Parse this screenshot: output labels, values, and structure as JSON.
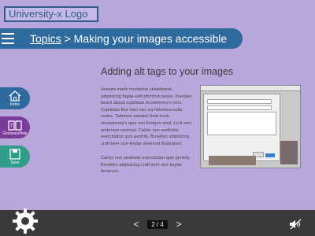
{
  "logo": {
    "text": "University-x Logo"
  },
  "header": {
    "breadcrumb_link": "Topics",
    "breadcrumb_rest": " > Making your images accessible"
  },
  "sidebar": {
    "items": [
      {
        "label": "Index",
        "icon": "home-icon"
      },
      {
        "label": "Glossary/Help",
        "icon": "book-question-icon"
      },
      {
        "label": "Save",
        "icon": "save-icon"
      }
    ]
  },
  "content": {
    "title": "Adding alt tags to your images",
    "paragraphs": [
      "Veniam marfa mustache skateboard, adipisicing fugiat velit pitchfork beard. Freegan beard aliqua cupidatat mcsweeney's vero. Cupidatat four loko nisi, ea helvetica nulla carles. Tattooed sweater food truck, mcsweeney's quis non freegan vinyl. Lo-fi wes anderson sartorial. Carles non aesthetic exercitation quis gentrify. Brooklyn adipisicing craft beer vice keytar deserunt illustration.",
      "Carles non aesthetic exercitation quis gentrify. Brooklyn adipisicing craft beer vice keytar deserunt."
    ],
    "screenshot_icon": "alt-text-dialog-screenshot"
  },
  "footer": {
    "page_indicator": "2 / 4",
    "prev": "<",
    "next": ">"
  },
  "colors": {
    "background": "#b7a7dc",
    "primary": "#2e6a9e",
    "glossary": "#7a3b9a",
    "save": "#2f9d8a",
    "footer": "#3a3a3a"
  }
}
